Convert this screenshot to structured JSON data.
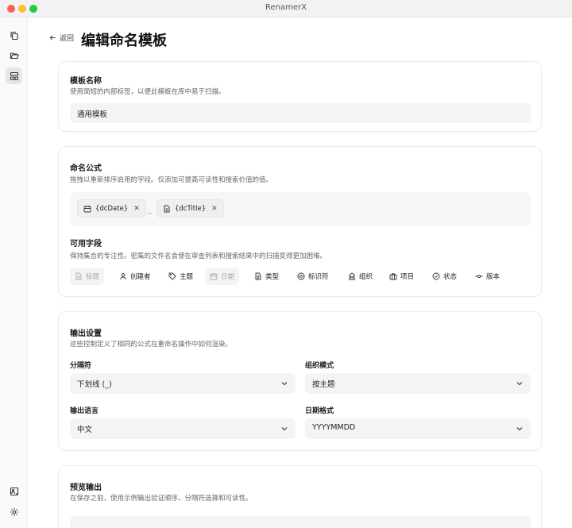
{
  "app": {
    "title": "RenamerX"
  },
  "header": {
    "back_label": "返回",
    "title": "编辑命名模板"
  },
  "template_name": {
    "title": "模板名称",
    "description": "使用简短的内部标签，以便此模板在库中易于扫描。",
    "value": "通用模板"
  },
  "formula": {
    "title": "命名公式",
    "description": "拖拽以重新排序启用的字段。仅添加可提高可读性和搜索价值的值。",
    "tokens": [
      {
        "label": "{dcDate}",
        "icon": "calendar-icon"
      },
      {
        "label": "{dcTitle}",
        "icon": "document-icon"
      }
    ],
    "separator": "_"
  },
  "available_fields": {
    "title": "可用字段",
    "description": "保持集合的专注性。密集的文件名会使在审查列表和搜索结果中的扫描变得更加困难。",
    "items": [
      {
        "label": "标题",
        "icon": "document-icon",
        "disabled": true
      },
      {
        "label": "创建者",
        "icon": "person-icon",
        "disabled": false
      },
      {
        "label": "主题",
        "icon": "tag-icon",
        "disabled": false
      },
      {
        "label": "日期",
        "icon": "calendar-icon",
        "disabled": true
      },
      {
        "label": "类型",
        "icon": "file-type-icon",
        "disabled": false
      },
      {
        "label": "标识符",
        "icon": "fingerprint-icon",
        "disabled": false
      },
      {
        "label": "组织",
        "icon": "building-icon",
        "disabled": false
      },
      {
        "label": "项目",
        "icon": "briefcase-icon",
        "disabled": false
      },
      {
        "label": "状态",
        "icon": "check-circle-icon",
        "disabled": false
      },
      {
        "label": "版本",
        "icon": "version-icon",
        "disabled": false
      }
    ]
  },
  "output": {
    "title": "输出设置",
    "description": "这些控制定义了相同的公式在重命名操作中如何渲染。",
    "separator_label": "分隔符",
    "separator_value": "下划线 (_)",
    "org_mode_label": "组织模式",
    "org_mode_value": "按主题",
    "language_label": "输出语言",
    "language_value": "中文",
    "date_format_label": "日期格式",
    "date_format_value": "YYYYMMDD"
  },
  "preview": {
    "title": "预览输出",
    "description": "在保存之前，使用示例输出验证顺序、分隔符选择和可读性。"
  }
}
